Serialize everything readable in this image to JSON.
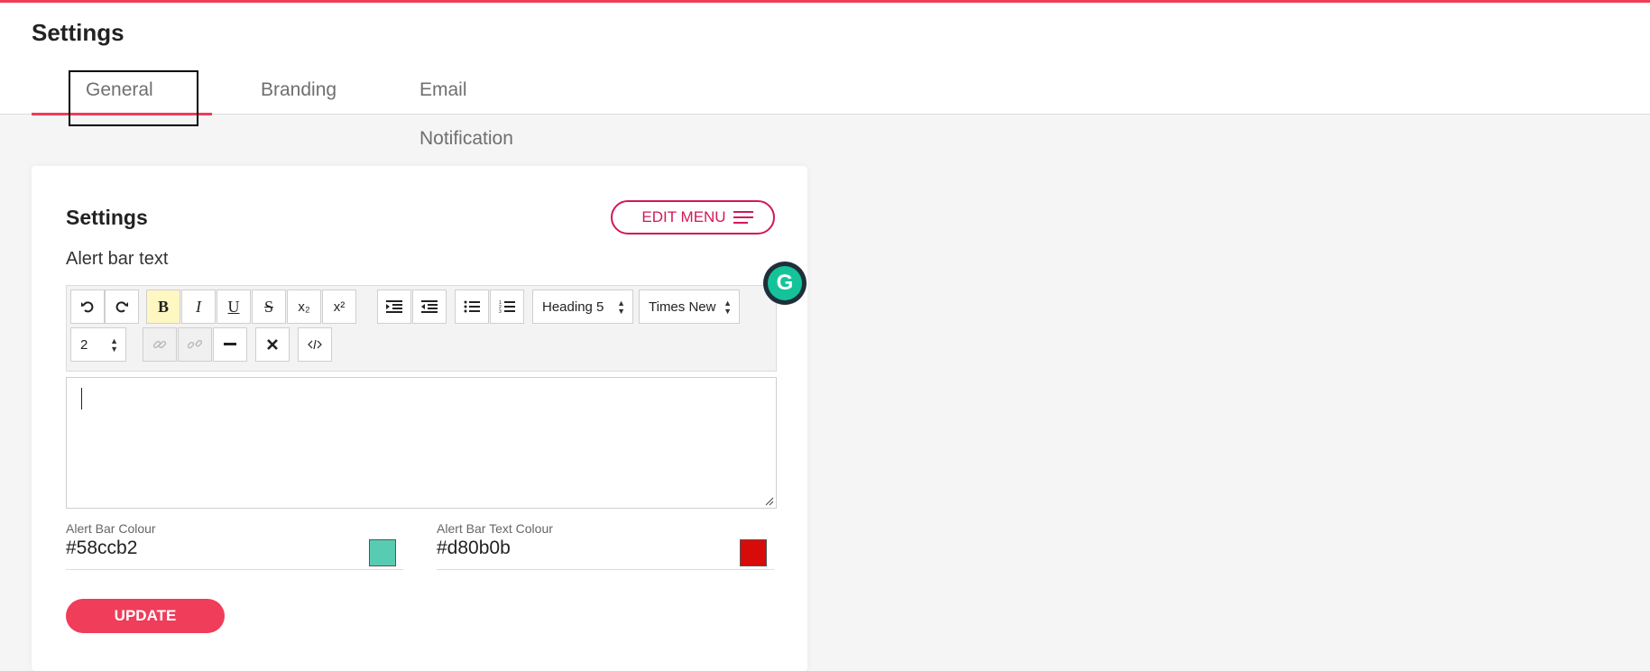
{
  "header": {
    "title": "Settings",
    "tabs": [
      {
        "label": "General",
        "active": true
      },
      {
        "label": "Branding",
        "active": false
      },
      {
        "label": "Email Notification",
        "active": false
      }
    ]
  },
  "card": {
    "title": "Settings",
    "edit_menu_label": "EDIT MENU",
    "field_label": "Alert bar text",
    "toolbar": {
      "heading_select": "Heading 5",
      "font_select": "Times New",
      "size_select": "2",
      "buttons": [
        "undo",
        "redo",
        "bold",
        "italic",
        "underline",
        "strikethrough",
        "subscript",
        "superscript",
        "indent",
        "outdent",
        "unordered-list",
        "ordered-list",
        "link",
        "unlink",
        "horizontal-rule",
        "remove-format",
        "code-view"
      ],
      "glyphs": {
        "bold": "B",
        "italic": "I",
        "underline": "U",
        "strike": "S",
        "sub": "x₂",
        "sup": "x²"
      }
    },
    "editor_value": "",
    "alert_bar_colour": {
      "label": "Alert Bar Colour",
      "value": "#58ccb2"
    },
    "alert_bar_text_colour": {
      "label": "Alert Bar Text Colour",
      "value": "#d80b0b"
    },
    "update_label": "UPDATE"
  },
  "colors": {
    "accent": "#ef3d5a",
    "edit_menu": "#d1185a",
    "grammarly": "#15c39a"
  },
  "icons": {
    "grammarly": "G"
  }
}
